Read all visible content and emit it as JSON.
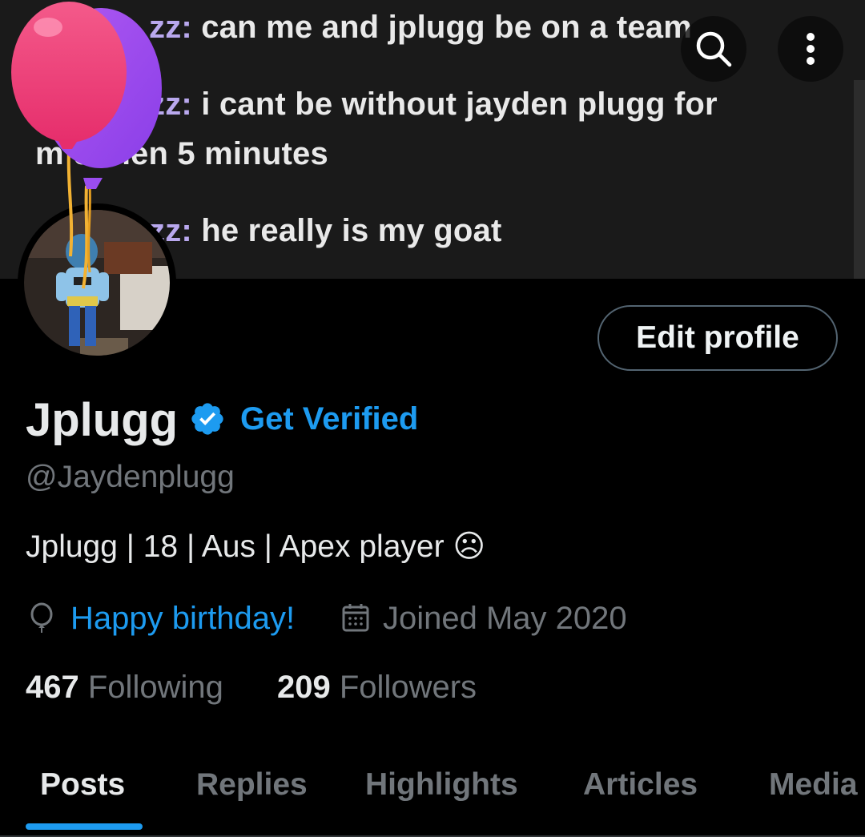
{
  "banner": {
    "chat_lines": [
      {
        "name": "zz:",
        "text": " can me and jplugg be on a team"
      },
      {
        "name": "zz:",
        "text": " i cant be without jayden plugg for"
      },
      {
        "name": "",
        "text": "m    e then 5 minutes"
      },
      {
        "name": "zz:",
        "text": " he really is my goat"
      }
    ]
  },
  "icons": {
    "search": "search-icon",
    "more": "more-vertical-icon",
    "verified": "verified-badge-icon",
    "balloon": "birthday-balloon-icon",
    "birthday": "balloon-outline-icon",
    "calendar": "calendar-icon"
  },
  "colors": {
    "accent": "#1d9bf0",
    "muted": "#71767b",
    "background": "#000000",
    "balloon_pink": "#f0407a",
    "balloon_purple": "#9b4df0"
  },
  "profile": {
    "edit_label": "Edit profile",
    "display_name": "Jplugg",
    "get_verified": "Get Verified",
    "handle": "@Jaydenplugg",
    "bio": "Jplugg | 18 | Aus | Apex player ☹",
    "birthday": "Happy birthday!",
    "joined": "Joined May 2020"
  },
  "stats": {
    "following_count": "467",
    "following_label": "Following",
    "followers_count": "209",
    "followers_label": "Followers"
  },
  "tabs": [
    {
      "label": "Posts",
      "active": true
    },
    {
      "label": "Replies",
      "active": false
    },
    {
      "label": "Highlights",
      "active": false
    },
    {
      "label": "Articles",
      "active": false
    },
    {
      "label": "Media",
      "active": false
    }
  ]
}
